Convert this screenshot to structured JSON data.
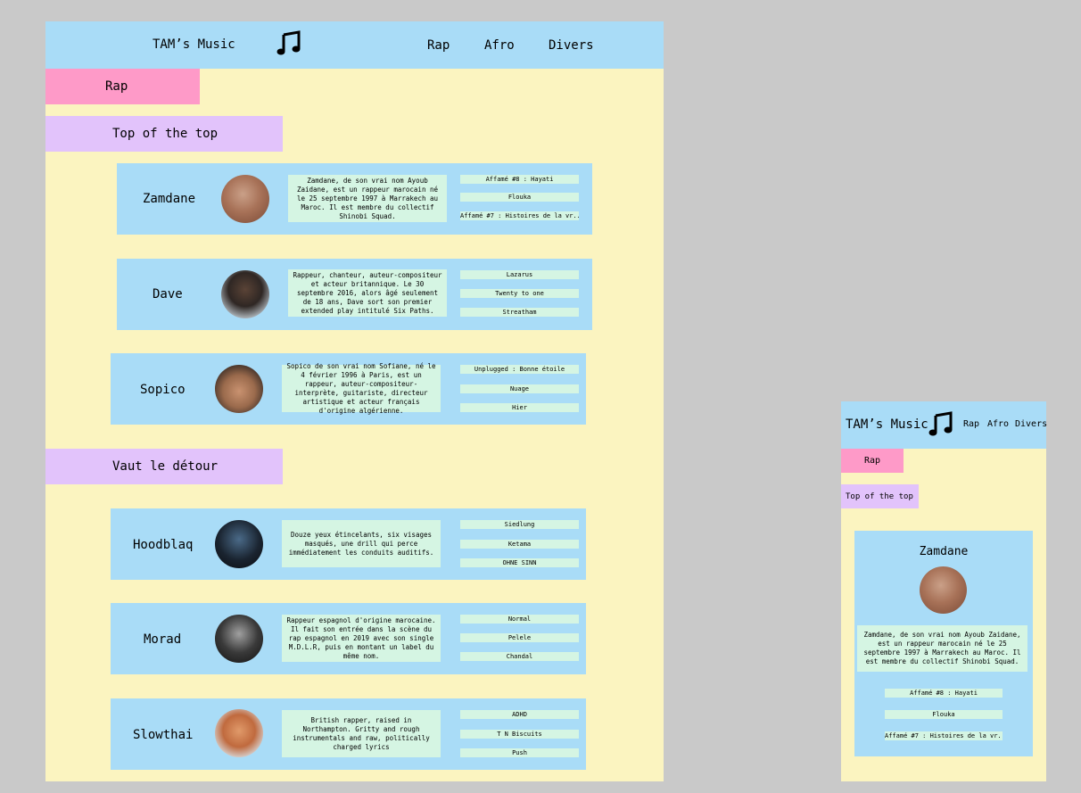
{
  "desktop": {
    "header": {
      "title": "TAM’s Music",
      "logo_icon": "music-note-icon",
      "nav": [
        "Rap",
        "Afro",
        "Divers"
      ]
    },
    "category": "Rap",
    "sections": [
      {
        "title": "Top of the top",
        "artists": [
          {
            "name": "Zamdane",
            "description": "Zamdane, de son vrai nom Ayoub Zaidane, est un rappeur marocain né le 25 septembre 1997 à Marrakech au Maroc. Il est membre du collectif Shinobi Squad.",
            "songs": [
              "Affamé #8 : Hayati",
              "Flouka",
              "Affamé #7 : Histoires de la vr.."
            ]
          },
          {
            "name": "Dave",
            "description": "Rappeur, chanteur, auteur-compositeur et acteur britannique. Le 30 septembre 2016, alors âgé seulement de 18 ans, Dave sort son premier extended play intitulé Six Paths.",
            "songs": [
              "Lazarus",
              "Twenty to one",
              "Streatham"
            ]
          },
          {
            "name": "Sopico",
            "description": "Sopico de son vrai nom Sofiane, né le 4 février 1996 à Paris, est un rappeur, auteur-compositeur-interprète, guitariste, directeur artistique et acteur français d'origine algérienne.",
            "songs": [
              "Unplugged : Bonne étoile",
              "Nuage",
              "Hier"
            ]
          }
        ]
      },
      {
        "title": "Vaut le détour",
        "artists": [
          {
            "name": "Hoodblaq",
            "description": "Douze yeux étincelants, six visages masqués, une drill qui perce immédiatement les conduits auditifs.",
            "songs": [
              "Siedlung",
              "Ketama",
              "OHNE SINN"
            ]
          },
          {
            "name": "Morad",
            "description": "Rappeur espagnol d'origine marocaine. Il fait son entrée dans la scène du rap espagnol en 2019 avec son single M.D.L.R, puis en montant un label du même nom.",
            "songs": [
              "Normal",
              "Pelele",
              "Chandal"
            ]
          },
          {
            "name": "Slowthai",
            "description": "British rapper, raised in Northampton. Gritty and rough instrumentals and raw, politically charged lyrics",
            "songs": [
              "ADHD",
              "T N Biscuits",
              "Push"
            ]
          }
        ]
      }
    ]
  },
  "mobile": {
    "header": {
      "title": "TAM’s Music",
      "logo_icon": "music-note-icon",
      "nav": [
        "Rap",
        "Afro",
        "Divers"
      ]
    },
    "category": "Rap",
    "section_title": "Top of the top",
    "artist": {
      "name": "Zamdane",
      "description": "Zamdane, de son vrai nom Ayoub Zaidane, est un rappeur marocain né le 25 septembre 1997 à Marrakech au Maroc. Il est membre du collectif Shinobi Squad.",
      "songs": [
        "Affamé #8 : Hayati",
        "Flouka",
        "Affamé #7 : Histoires de la vr.."
      ]
    }
  }
}
